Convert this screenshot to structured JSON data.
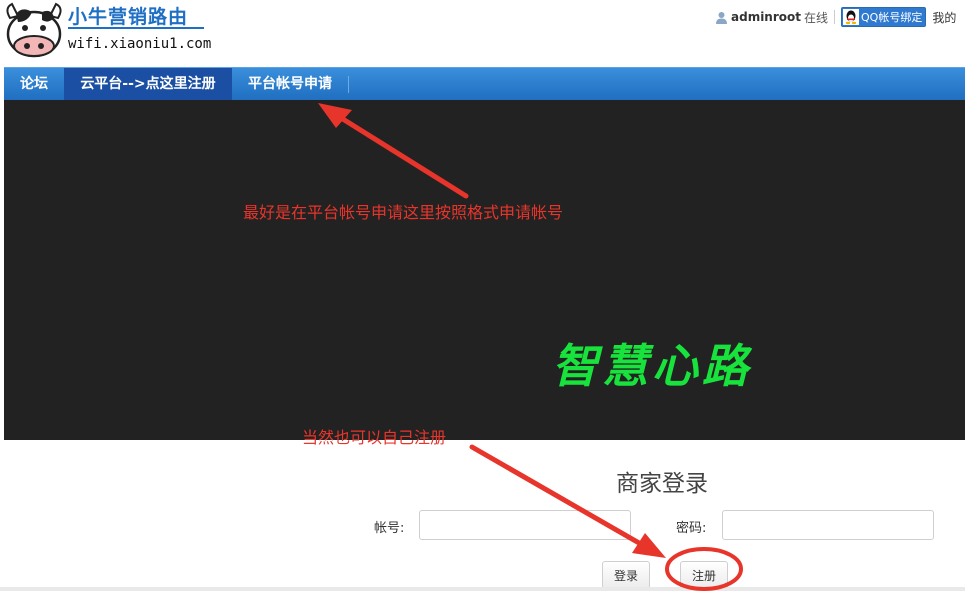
{
  "header": {
    "brand_title": "小牛营销路由",
    "brand_url": "wifi.xiaoniu1.com",
    "user": {
      "name": "adminroot",
      "status": "在线",
      "qq_button": "QQ帐号绑定",
      "mine_link": "我的"
    }
  },
  "nav": {
    "items": [
      {
        "label": "论坛",
        "active": false
      },
      {
        "label": "云平台-->点这里注册",
        "active": true
      },
      {
        "label": "平台帐号申请",
        "active": false
      }
    ]
  },
  "banner": {
    "logo_text": "智慧心路",
    "logo_color": "#18e33c",
    "background": "#222222"
  },
  "annotations": {
    "note1": "最好是在平台帐号申请这里按照格式申请帐号",
    "note2": "当然也可以自己注册",
    "color": "#e8352b"
  },
  "login": {
    "title": "商家登录",
    "account_label": "帐号:",
    "account_value": "",
    "password_label": "密码:",
    "password_value": "",
    "login_button": "登录",
    "register_button": "注册"
  },
  "colors": {
    "nav_blue": "#2f7ad0",
    "nav_active": "#1a4fa3",
    "brand_blue": "#1f6fc4"
  }
}
